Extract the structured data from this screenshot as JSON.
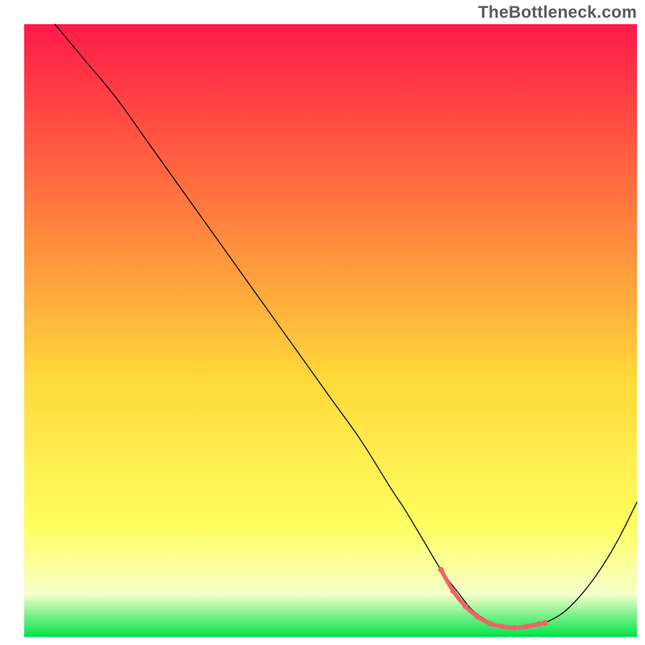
{
  "watermark": "TheBottleneck.com",
  "chart_data": {
    "type": "line",
    "title": "",
    "xlabel": "",
    "ylabel": "",
    "xlim": [
      0,
      100
    ],
    "ylim": [
      0,
      100
    ],
    "grid": false,
    "legend": false,
    "background_gradient": {
      "top": "#ff1a49",
      "mid1": "#ff7a3e",
      "mid2": "#ffd93a",
      "mid3": "#ffff60",
      "band": "#f6ffca",
      "bottom": "#00e24a"
    },
    "series": [
      {
        "name": "main-curve",
        "color": "#000000",
        "stroke_width": 1.2,
        "x": [
          5,
          10,
          15,
          20,
          25,
          30,
          35,
          40,
          45,
          50,
          55,
          60,
          62,
          65,
          68,
          71,
          73,
          75,
          77,
          79,
          81,
          83,
          85,
          88,
          91,
          94,
          97,
          100
        ],
        "y": [
          100,
          94,
          88,
          81,
          74,
          67,
          60,
          53,
          46,
          39,
          32,
          24,
          21,
          16,
          11,
          7,
          4.5,
          3,
          2,
          1.5,
          1.5,
          1.7,
          2.3,
          4,
          7,
          11,
          16,
          22
        ]
      },
      {
        "name": "highlight-segment",
        "color": "#ef6464",
        "stroke_width": 5,
        "x": [
          68,
          70,
          72,
          74,
          76,
          78,
          80,
          82,
          84,
          85
        ],
        "y": [
          11,
          7.5,
          5,
          3.3,
          2.2,
          1.7,
          1.5,
          1.7,
          2.1,
          2.3
        ]
      },
      {
        "name": "highlight-dots",
        "color": "#ef6464",
        "marker_radius": 3.5,
        "render_as": "points",
        "x": [
          68,
          70,
          72,
          74,
          76,
          78,
          80,
          82,
          84,
          85
        ],
        "y": [
          11,
          7.5,
          5,
          3.3,
          2.2,
          1.7,
          1.5,
          1.7,
          2.1,
          2.3
        ]
      }
    ]
  }
}
